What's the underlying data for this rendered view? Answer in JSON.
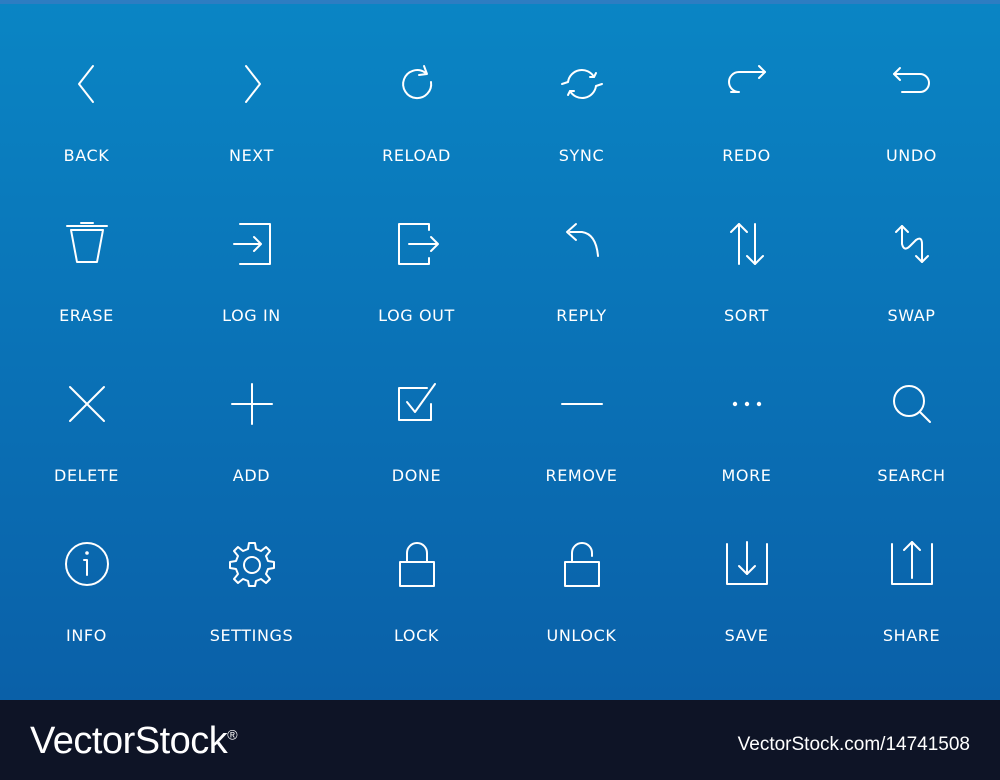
{
  "colors": {
    "background_top": "#0a85c4",
    "background_bottom": "#0a60a8",
    "icon": "#ffffff",
    "footer": "#0e1426"
  },
  "icons": [
    {
      "name": "back-icon",
      "label": "BACK"
    },
    {
      "name": "next-icon",
      "label": "NEXT"
    },
    {
      "name": "reload-icon",
      "label": "RELOAD"
    },
    {
      "name": "sync-icon",
      "label": "SYNC"
    },
    {
      "name": "redo-icon",
      "label": "REDO"
    },
    {
      "name": "undo-icon",
      "label": "UNDO"
    },
    {
      "name": "erase-icon",
      "label": "ERASE"
    },
    {
      "name": "log-in-icon",
      "label": "LOG IN"
    },
    {
      "name": "log-out-icon",
      "label": "LOG OUT"
    },
    {
      "name": "reply-icon",
      "label": "REPLY"
    },
    {
      "name": "sort-icon",
      "label": "SORT"
    },
    {
      "name": "swap-icon",
      "label": "SWAP"
    },
    {
      "name": "delete-icon",
      "label": "DELETE"
    },
    {
      "name": "add-icon",
      "label": "ADD"
    },
    {
      "name": "done-icon",
      "label": "DONE"
    },
    {
      "name": "remove-icon",
      "label": "REMOVE"
    },
    {
      "name": "more-icon",
      "label": "MORE"
    },
    {
      "name": "search-icon",
      "label": "SEARCH"
    },
    {
      "name": "info-icon",
      "label": "INFO"
    },
    {
      "name": "settings-icon",
      "label": "SETTINGS"
    },
    {
      "name": "lock-icon",
      "label": "LOCK"
    },
    {
      "name": "unlock-icon",
      "label": "UNLOCK"
    },
    {
      "name": "save-icon",
      "label": "SAVE"
    },
    {
      "name": "share-icon",
      "label": "SHARE"
    }
  ],
  "footer": {
    "brand": "VectorStock",
    "registered": "®",
    "stock_id": "VectorStock.com/14741508"
  }
}
